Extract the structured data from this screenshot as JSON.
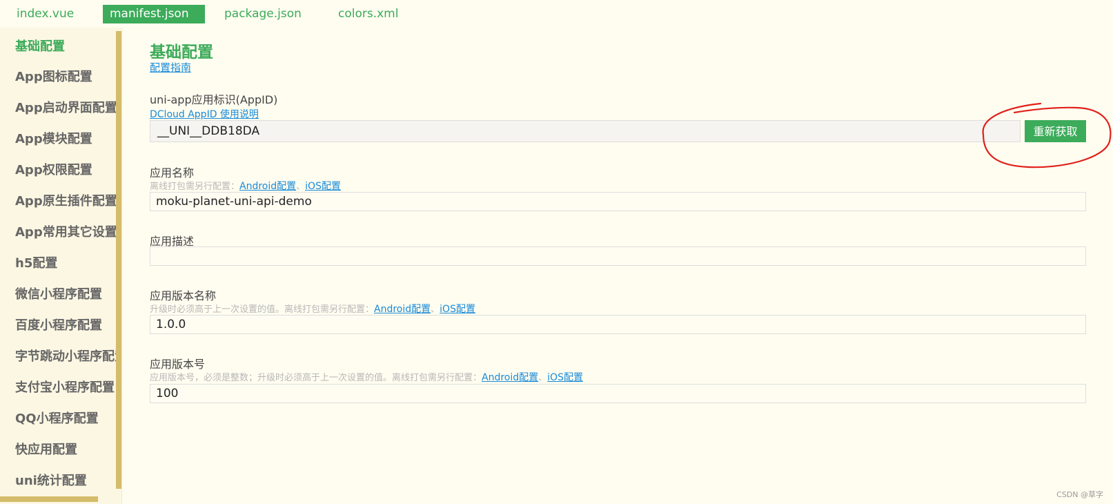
{
  "tabs": [
    "index.vue",
    "manifest.json",
    "package.json",
    "colors.xml"
  ],
  "active_tab": "manifest.json",
  "sidebar": {
    "items": [
      "基础配置",
      "App图标配置",
      "App启动界面配置",
      "App模块配置",
      "App权限配置",
      "App原生插件配置",
      "App常用其它设置",
      "h5配置",
      "微信小程序配置",
      "百度小程序配置",
      "字节跳动小程序配置",
      "支付宝小程序配置",
      "QQ小程序配置",
      "快应用配置",
      "uni统计配置"
    ],
    "active": "基础配置"
  },
  "main": {
    "title": "基础配置",
    "guide_link": "配置指南",
    "appid": {
      "label": "uni-app应用标识(AppID)",
      "help_link": "DCloud AppID 使用说明",
      "value": "__UNI__DDB18DA",
      "button": "重新获取"
    },
    "app_name": {
      "label": "应用名称",
      "hint": "离线打包需另行配置：",
      "value": "moku-planet-uni-api-demo"
    },
    "app_desc": {
      "label": "应用描述",
      "value": ""
    },
    "version_name": {
      "label": "应用版本名称",
      "hint": "升级时必须高于上一次设置的值。离线打包需另行配置：",
      "value": "1.0.0"
    },
    "version_code": {
      "label": "应用版本号",
      "hint": "应用版本号，必须是整数；升级时必须高于上一次设置的值。离线打包需另行配置：",
      "value": "100"
    },
    "android_link": "Android配置",
    "ios_link": "iOS配置",
    "separator": "、"
  },
  "watermark": "CSDN @草字",
  "colors": {
    "accent": "#3cab5a",
    "link": "#1a8ad8",
    "background": "#fffdf0",
    "scrollbar": "#d4bc6a",
    "annotation": "#e0201a"
  }
}
